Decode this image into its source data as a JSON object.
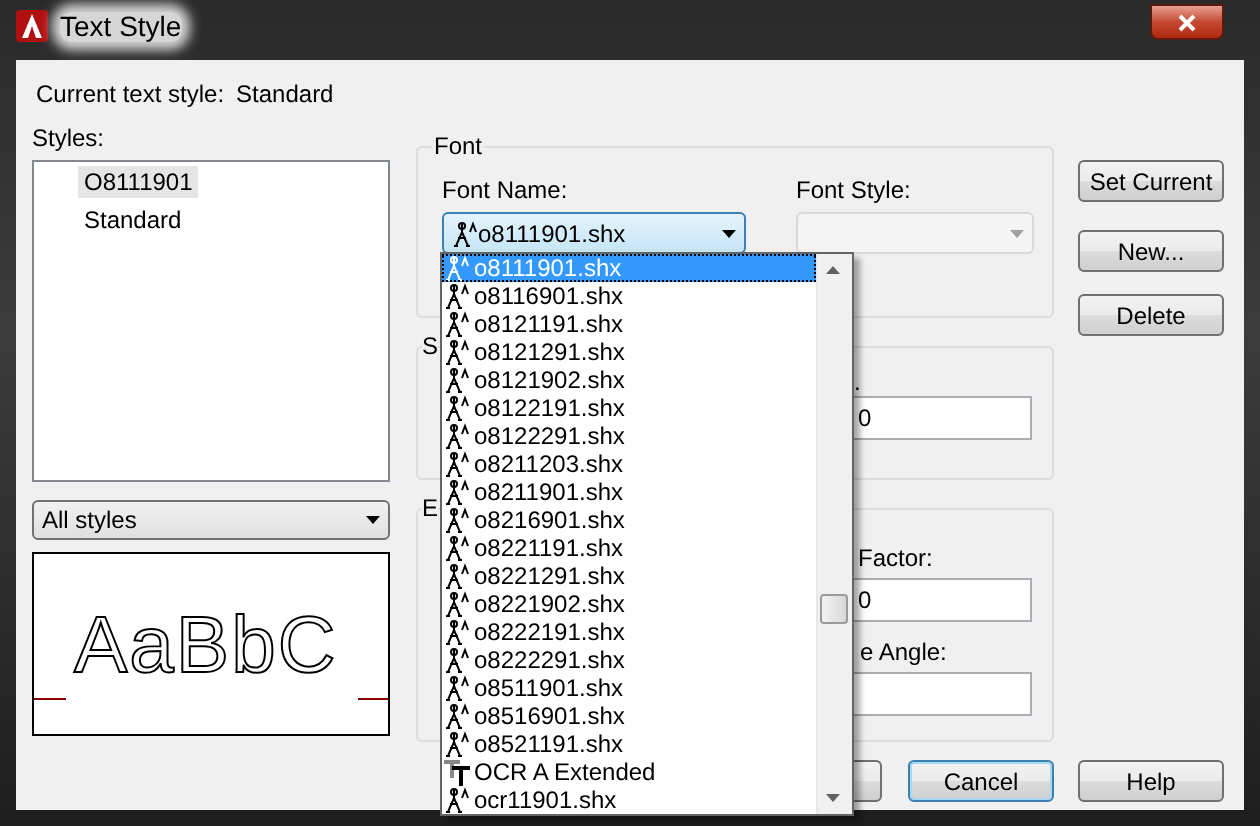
{
  "window": {
    "title": "Text Style"
  },
  "current_style": {
    "label": "Current text style:",
    "value": "Standard"
  },
  "styles": {
    "label": "Styles:",
    "items": [
      {
        "label": "O8111901",
        "selected": true
      },
      {
        "label": "Standard",
        "selected": false
      }
    ]
  },
  "filter": {
    "value": "All styles"
  },
  "preview": {
    "text": "AaBbC"
  },
  "font": {
    "label": "Font",
    "font_name": {
      "label": "Font Name:",
      "value": "o8111901.shx",
      "expanded": true
    },
    "font_style": {
      "label": "Font Style:",
      "disabled": true
    },
    "options": [
      {
        "label": "o8111901.shx",
        "kind": "shx",
        "selected": true
      },
      {
        "label": "o8116901.shx",
        "kind": "shx",
        "selected": false
      },
      {
        "label": "o8121191.shx",
        "kind": "shx",
        "selected": false
      },
      {
        "label": "o8121291.shx",
        "kind": "shx",
        "selected": false
      },
      {
        "label": "o8121902.shx",
        "kind": "shx",
        "selected": false
      },
      {
        "label": "o8122191.shx",
        "kind": "shx",
        "selected": false
      },
      {
        "label": "o8122291.shx",
        "kind": "shx",
        "selected": false
      },
      {
        "label": "o8211203.shx",
        "kind": "shx",
        "selected": false
      },
      {
        "label": "o8211901.shx",
        "kind": "shx",
        "selected": false
      },
      {
        "label": "o8216901.shx",
        "kind": "shx",
        "selected": false
      },
      {
        "label": "o8221191.shx",
        "kind": "shx",
        "selected": false
      },
      {
        "label": "o8221291.shx",
        "kind": "shx",
        "selected": false
      },
      {
        "label": "o8221902.shx",
        "kind": "shx",
        "selected": false
      },
      {
        "label": "o8222191.shx",
        "kind": "shx",
        "selected": false
      },
      {
        "label": "o8222291.shx",
        "kind": "shx",
        "selected": false
      },
      {
        "label": "o8511901.shx",
        "kind": "shx",
        "selected": false
      },
      {
        "label": "o8516901.shx",
        "kind": "shx",
        "selected": false
      },
      {
        "label": "o8521191.shx",
        "kind": "shx",
        "selected": false
      },
      {
        "label": "OCR A Extended",
        "kind": "truetype",
        "selected": false
      },
      {
        "label": "ocr11901.shx",
        "kind": "shx",
        "selected": false
      }
    ]
  },
  "size": {
    "label": "S",
    "height_label": ".",
    "height_value": "0"
  },
  "effects": {
    "label": "E",
    "width_label": "Factor:",
    "width_value": "0",
    "angle_label": "e Angle:"
  },
  "side_buttons": [
    "Set Current",
    "New...",
    "Delete"
  ],
  "bottom_buttons": [
    "Cancel",
    "Help"
  ]
}
